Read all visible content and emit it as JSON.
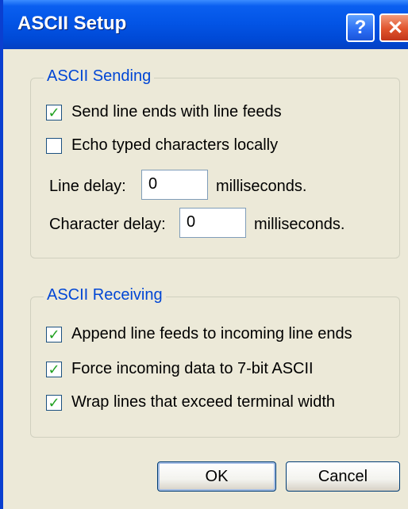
{
  "window": {
    "title": "ASCII Setup"
  },
  "titlebar": {
    "help_glyph": "?",
    "close_glyph": "✕"
  },
  "sending": {
    "title": "ASCII Sending",
    "send_line_ends": {
      "label": "Send line ends with line feeds",
      "checked": true
    },
    "echo_typed": {
      "label": "Echo typed characters locally",
      "checked": false
    },
    "line_delay": {
      "label": "Line delay:",
      "value": "0",
      "unit": "milliseconds."
    },
    "char_delay": {
      "label": "Character delay:",
      "value": "0",
      "unit": "milliseconds."
    }
  },
  "receiving": {
    "title": "ASCII Receiving",
    "append_line_feeds": {
      "label": "Append line feeds to incoming line ends",
      "checked": true
    },
    "force_7bit": {
      "label": "Force incoming data to 7-bit ASCII",
      "checked": true
    },
    "wrap_lines": {
      "label": "Wrap lines that exceed terminal width",
      "checked": true
    }
  },
  "buttons": {
    "ok": "OK",
    "cancel": "Cancel"
  },
  "check_mark": "✓",
  "colors": {
    "titlebar": "#0355e6",
    "group_title": "#0046d5",
    "dialog_bg": "#ece9d8",
    "check": "#21a121"
  }
}
